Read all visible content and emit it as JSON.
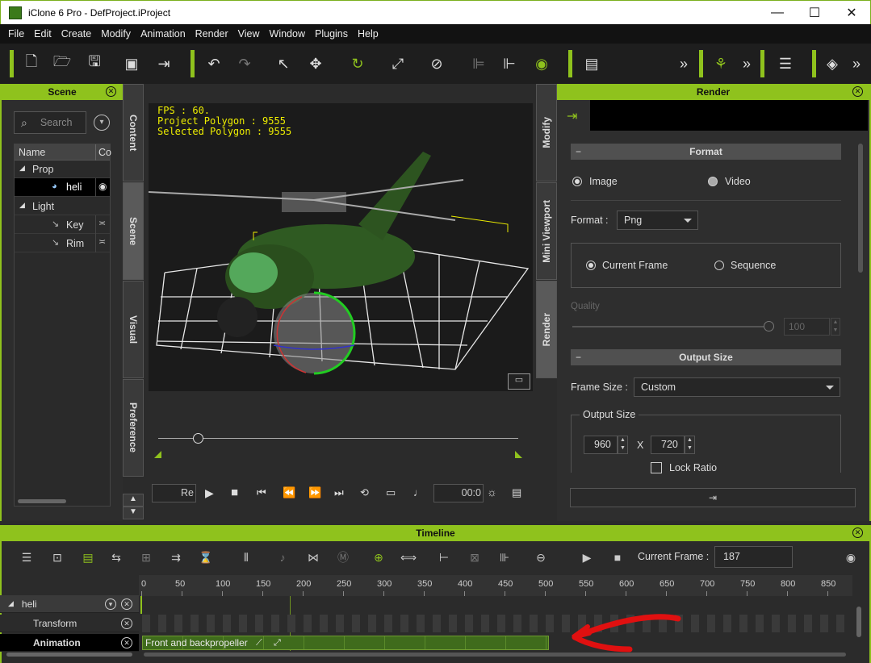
{
  "window": {
    "title": "iClone 6 Pro - DefProject.iProject"
  },
  "menu": [
    "File",
    "Edit",
    "Create",
    "Modify",
    "Animation",
    "Render",
    "View",
    "Window",
    "Plugins",
    "Help"
  ],
  "scene_panel": {
    "title": "Scene",
    "search_placeholder": "Search",
    "columns": [
      "Name",
      "Co"
    ],
    "tree": [
      {
        "label": "Prop",
        "indent": 0,
        "expanded": true
      },
      {
        "label": "heli",
        "indent": 1,
        "selected": true
      },
      {
        "label": "Light",
        "indent": 0,
        "expanded": true
      },
      {
        "label": "Key",
        "indent": 1
      },
      {
        "label": "Rim",
        "indent": 1
      }
    ]
  },
  "left_tabs": [
    "Content",
    "Scene",
    "Visual",
    "Preference"
  ],
  "right_tabs": [
    "Modify",
    "Mini Viewport",
    "Render"
  ],
  "viewport": {
    "fps": "FPS : 60.",
    "project_polygon": "Project Polygon : 9555",
    "selected_polygon": "Selected Polygon : 9555"
  },
  "playback": {
    "mode": "Re",
    "time": "00:0"
  },
  "render_panel": {
    "title": "Render",
    "format_header": "Format",
    "image_label": "Image",
    "video_label": "Video",
    "format_label": "Format :",
    "format_value": "Png",
    "current_frame_label": "Current Frame",
    "sequence_label": "Sequence",
    "quality_label": "Quality",
    "quality_value": "100",
    "output_size_header": "Output Size",
    "frame_size_label": "Frame Size :",
    "frame_size_value": "Custom",
    "output_size_group": "Output Size",
    "width": "960",
    "x_label": "X",
    "height": "720",
    "lock_ratio_label": "Lock Ratio"
  },
  "timeline": {
    "title": "Timeline",
    "current_frame_label": "Current Frame :",
    "current_frame": "187",
    "ticks": [
      "0",
      "50",
      "100",
      "150",
      "200",
      "250",
      "300",
      "350",
      "400",
      "450",
      "500",
      "550",
      "600",
      "650",
      "700",
      "750",
      "800",
      "850"
    ],
    "tracks": {
      "object": "heli",
      "transform": "Transform",
      "animation": "Animation"
    },
    "clip_label": "Front and backpropeller"
  },
  "colors": {
    "accent": "#8fc21d",
    "annotation_arrow": "#e01010"
  }
}
